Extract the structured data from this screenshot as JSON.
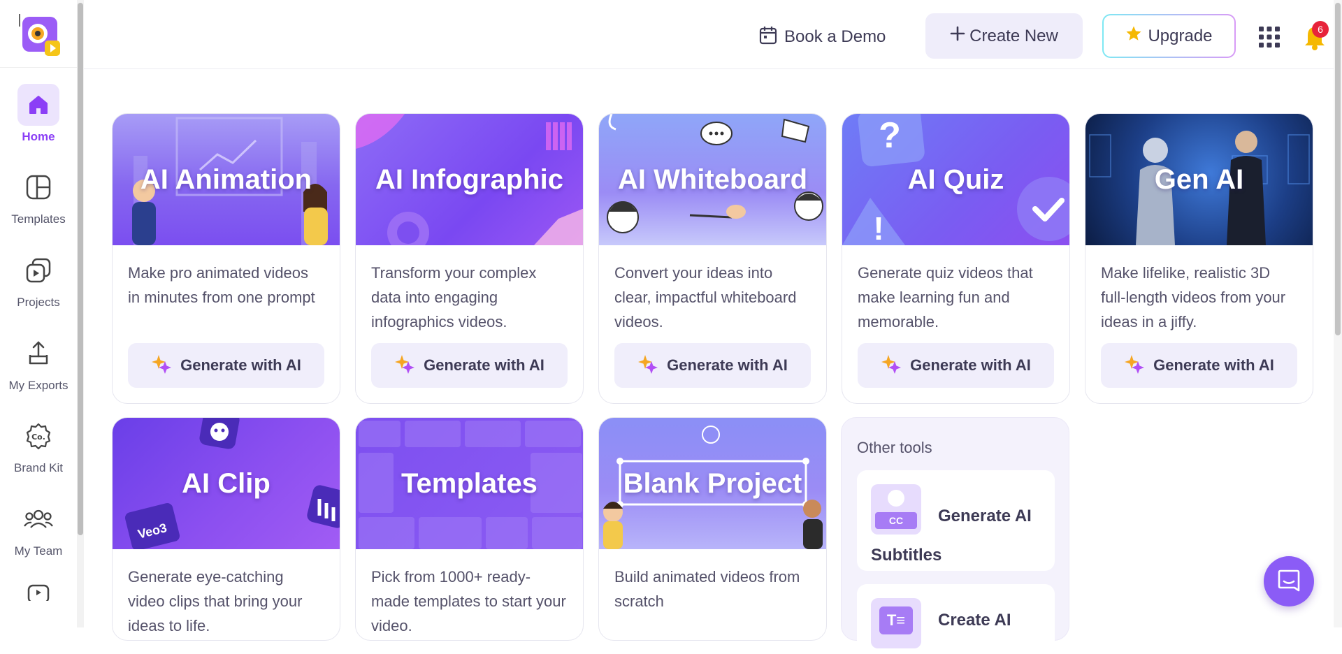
{
  "sidebar": {
    "items": [
      {
        "label": "Home",
        "icon": "home-icon"
      },
      {
        "label": "Templates",
        "icon": "templates-icon"
      },
      {
        "label": "Projects",
        "icon": "projects-icon"
      },
      {
        "label": "My Exports",
        "icon": "exports-icon"
      },
      {
        "label": "Brand Kit",
        "icon": "brand-kit-icon"
      },
      {
        "label": "My Team",
        "icon": "team-icon"
      }
    ]
  },
  "header": {
    "book_demo": "Book a Demo",
    "create_new": "Create New",
    "upgrade": "Upgrade",
    "notification_count": "6"
  },
  "cards": [
    {
      "title": "AI Animation",
      "desc": "Make pro animated videos in minutes from one prompt",
      "button": "Generate with AI"
    },
    {
      "title": "AI Infographic",
      "desc": "Transform your complex data into engaging infographics videos.",
      "button": "Generate with AI"
    },
    {
      "title": "AI Whiteboard",
      "desc": "Convert your ideas into clear, impactful whiteboard videos.",
      "button": "Generate with AI"
    },
    {
      "title": "AI Quiz",
      "desc": "Generate quiz videos that make learning fun and memorable.",
      "button": "Generate with AI"
    },
    {
      "title": "Gen AI",
      "desc": "Make lifelike, realistic 3D full-length videos from your ideas in a jiffy.",
      "button": "Generate with AI"
    },
    {
      "title": "AI Clip",
      "desc": "Generate eye-catching video clips that bring your ideas to life.",
      "badge": "Veo3"
    },
    {
      "title": "Templates",
      "desc": "Pick from 1000+ ready-made templates to start your video."
    },
    {
      "title": "Blank Project",
      "desc": "Build animated videos from scratch"
    }
  ],
  "other_tools": {
    "title": "Other tools",
    "items": [
      {
        "label": "Generate AI Subtitles",
        "icon_text": "CC"
      },
      {
        "label": "Create AI"
      }
    ]
  },
  "colors": {
    "accent": "#8b3ff6",
    "button_bg": "#f0eefb",
    "badge": "#e7233a"
  }
}
